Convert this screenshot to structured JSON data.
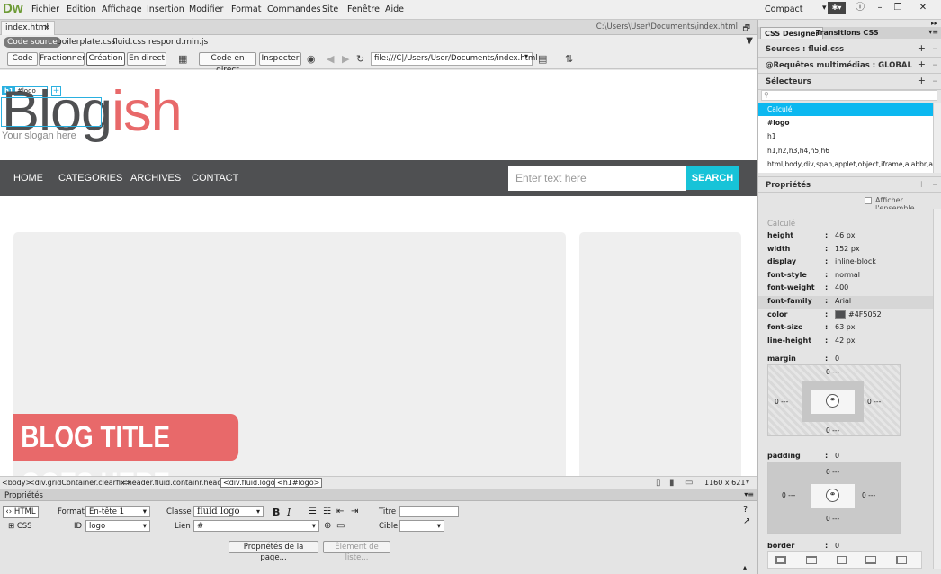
{
  "app": {
    "logo": "Dw",
    "compact": "Compact",
    "menu": [
      "Fichier",
      "Edition",
      "Affichage",
      "Insertion",
      "Modifier",
      "Format",
      "Commandes",
      "Site",
      "Fenêtre",
      "Aide"
    ]
  },
  "doc": {
    "tab": "index.html",
    "path": "C:\\Users\\User\\Documents\\index.html"
  },
  "related": [
    "Code source",
    "boilerplate.css",
    "fluid.css",
    "respond.min.js"
  ],
  "toolbar": {
    "views": [
      "Code",
      "Fractionner",
      "Création",
      "En direct"
    ],
    "code_live": "Code en direct",
    "inspect": "Inspecter",
    "url": "file:///C|/Users/User/Documents/index.html"
  },
  "page": {
    "selector_tag": "h1",
    "selector_id": "#logo",
    "logo_main": "Blog",
    "logo_accent": "ish",
    "slogan": "Your slogan here",
    "nav": [
      "HOME",
      "CATEGORIES",
      "ARCHIVES",
      "CONTACT"
    ],
    "search_placeholder": "Enter text here",
    "search_button": "SEARCH",
    "blog_title": "BLOG TITLE GOES HERE"
  },
  "status": {
    "crumbs": [
      "<body>",
      "<div.gridContainer.clearfix>",
      "<header.fluid.containr.headr>",
      "<div.fluid.logo>",
      "<h1#logo>"
    ],
    "size": "1160 x 621"
  },
  "properties": {
    "title": "Propriétés",
    "html": "HTML",
    "css": "CSS",
    "format_label": "Format",
    "format_value": "En-tête 1",
    "class_label": "Classe",
    "class_value": "fluid logo",
    "id_label": "ID",
    "id_value": "logo",
    "link_label": "Lien",
    "link_value": "#",
    "title_label": "Titre",
    "target_label": "Cible",
    "page_props": "Propriétés de la page...",
    "list_item": "Élément de liste..."
  },
  "css_panel": {
    "tabs": [
      "CSS Designer",
      "Transitions CSS"
    ],
    "sources": "Sources : fluid.css",
    "media": "@Requêtes multimédias : GLOBAL",
    "selectors": "Sélecteurs",
    "selector_items": [
      "Calculé",
      "#logo",
      "h1",
      "h1,h2,h3,h4,h5,h6",
      "html,body,div,span,applet,object,iframe,a,abbr,ac..."
    ],
    "props_title": "Propriétés",
    "show_all": "Afficher l'ensemble",
    "computed": "Calculé",
    "rows": [
      {
        "k": "height",
        "v": "46 px"
      },
      {
        "k": "width",
        "v": "152 px"
      },
      {
        "k": "display",
        "v": "inline-block"
      },
      {
        "k": "font-style",
        "v": "normal"
      },
      {
        "k": "font-weight",
        "v": "400"
      },
      {
        "k": "font-family",
        "v": "Arial"
      },
      {
        "k": "color",
        "v": "#4F5052"
      },
      {
        "k": "font-size",
        "v": "63 px"
      },
      {
        "k": "line-height",
        "v": "42 px"
      }
    ],
    "margin": "margin",
    "margin_val": "0",
    "padding": "padding",
    "padding_val": "0",
    "border": "border",
    "border_val": "0",
    "box_top": "0 ---",
    "box_left": "0 ---",
    "box_right": "0 ---",
    "box_bottom": "0 ---"
  },
  "colors": {
    "accent": "#e8696a",
    "nav": "#4f5052",
    "search": "#17c3d8",
    "selected": "#0cb8f0"
  }
}
